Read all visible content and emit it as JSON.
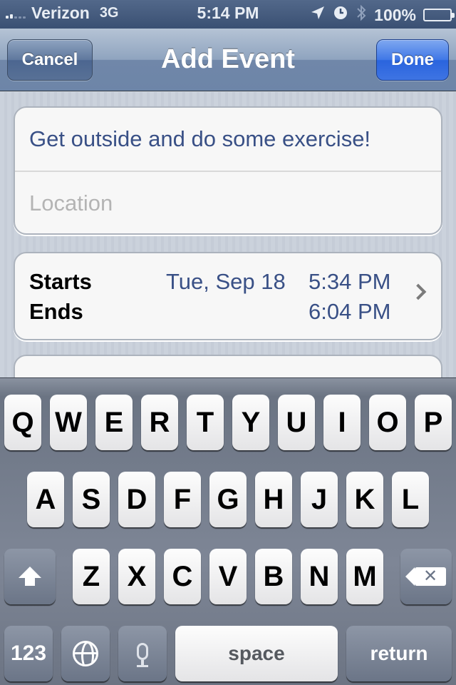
{
  "status_bar": {
    "carrier": "Verizon",
    "network": "3G",
    "time": "5:14 PM",
    "battery": "100%",
    "icons": [
      "signal-icon",
      "location-arrow-icon",
      "alarm-clock-icon",
      "bluetooth-icon",
      "battery-icon"
    ]
  },
  "nav": {
    "title": "Add Event",
    "cancel_label": "Cancel",
    "done_label": "Done"
  },
  "event": {
    "title_value": "Get outside and do some exercise!",
    "location_placeholder": "Location",
    "starts_label": "Starts",
    "ends_label": "Ends",
    "start_date": "Tue, Sep 18",
    "start_time": "5:34 PM",
    "end_time": "6:04 PM"
  },
  "keyboard": {
    "row1": [
      "Q",
      "W",
      "E",
      "R",
      "T",
      "Y",
      "U",
      "I",
      "O",
      "P"
    ],
    "row2": [
      "A",
      "S",
      "D",
      "F",
      "G",
      "H",
      "J",
      "K",
      "L"
    ],
    "row3": [
      "Z",
      "X",
      "C",
      "V",
      "B",
      "N",
      "M"
    ],
    "numbers_label": "123",
    "space_label": "space",
    "return_label": "return"
  },
  "colors": {
    "accent_blue": "#2a64de",
    "value_text": "#395086",
    "placeholder_text": "#b4b4b4"
  }
}
